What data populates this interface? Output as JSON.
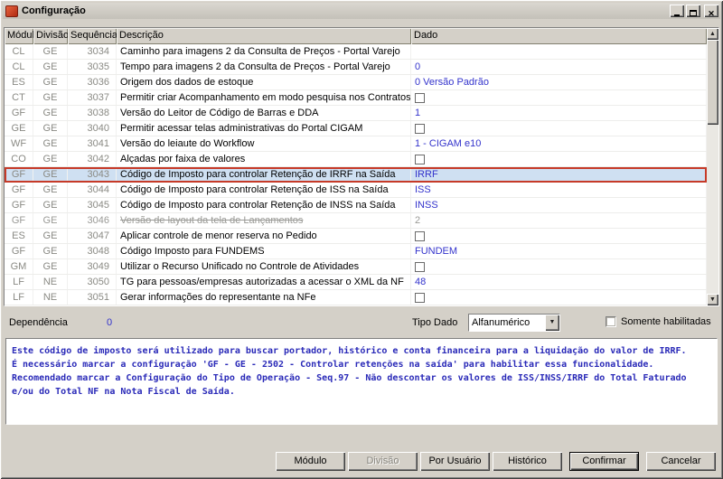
{
  "window": {
    "title": "Configuração"
  },
  "grid": {
    "columns": [
      "Módulo",
      "Divisão",
      "Sequência",
      "Descrição",
      "Dado"
    ],
    "rows": [
      {
        "modulo": "CL",
        "divisao": "GE",
        "seq": "3034",
        "descricao": "Caminho para imagens 2 da Consulta de Preços - Portal Varejo",
        "tipo": "text",
        "dado": "",
        "selected": false,
        "strike": false
      },
      {
        "modulo": "CL",
        "divisao": "GE",
        "seq": "3035",
        "descricao": "Tempo para imagens 2 da Consulta de Preços - Portal Varejo",
        "tipo": "text",
        "dado": "0",
        "selected": false,
        "strike": false
      },
      {
        "modulo": "ES",
        "divisao": "GE",
        "seq": "3036",
        "descricao": "Origem dos dados de estoque",
        "tipo": "text",
        "dado": "0 Versão Padrão",
        "selected": false,
        "strike": false
      },
      {
        "modulo": "CT",
        "divisao": "GE",
        "seq": "3037",
        "descricao": "Permitir criar Acompanhamento em modo pesquisa nos Contratos",
        "tipo": "checkbox",
        "dado": "",
        "selected": false,
        "strike": false
      },
      {
        "modulo": "GF",
        "divisao": "GE",
        "seq": "3038",
        "descricao": "Versão do Leitor de Código de Barras e DDA",
        "tipo": "text",
        "dado": "1",
        "selected": false,
        "strike": false
      },
      {
        "modulo": "GE",
        "divisao": "GE",
        "seq": "3040",
        "descricao": "Permitir acessar telas administrativas do Portal CIGAM",
        "tipo": "checkbox",
        "dado": "",
        "selected": false,
        "strike": false
      },
      {
        "modulo": "WF",
        "divisao": "GE",
        "seq": "3041",
        "descricao": "Versão do leiaute do Workflow",
        "tipo": "text",
        "dado": "1 - CIGAM e10",
        "selected": false,
        "strike": false
      },
      {
        "modulo": "CO",
        "divisao": "GE",
        "seq": "3042",
        "descricao": "Alçadas por faixa de valores",
        "tipo": "checkbox",
        "dado": "",
        "selected": false,
        "strike": false
      },
      {
        "modulo": "GF",
        "divisao": "GE",
        "seq": "3043",
        "descricao": "Código de Imposto para controlar Retenção de IRRF na Saída",
        "tipo": "text",
        "dado": "IRRF",
        "selected": true,
        "strike": false
      },
      {
        "modulo": "GF",
        "divisao": "GE",
        "seq": "3044",
        "descricao": "Código de Imposto para controlar Retenção de ISS na Saída",
        "tipo": "text",
        "dado": "ISS",
        "selected": false,
        "strike": false
      },
      {
        "modulo": "GF",
        "divisao": "GE",
        "seq": "3045",
        "descricao": "Código de Imposto para controlar Retenção de INSS na Saída",
        "tipo": "text",
        "dado": "INSS",
        "selected": false,
        "strike": false
      },
      {
        "modulo": "GF",
        "divisao": "GE",
        "seq": "3046",
        "descricao": "Versão de layout da tela de Lançamentos",
        "tipo": "text",
        "dado": "2",
        "selected": false,
        "strike": true
      },
      {
        "modulo": "ES",
        "divisao": "GE",
        "seq": "3047",
        "descricao": "Aplicar controle de menor reserva no Pedido",
        "tipo": "checkbox",
        "dado": "",
        "selected": false,
        "strike": false
      },
      {
        "modulo": "GF",
        "divisao": "GE",
        "seq": "3048",
        "descricao": "Código Imposto para FUNDEMS",
        "tipo": "text",
        "dado": "FUNDEM",
        "selected": false,
        "strike": false
      },
      {
        "modulo": "GM",
        "divisao": "GE",
        "seq": "3049",
        "descricao": "Utilizar o Recurso Unificado no Controle de Atividades",
        "tipo": "checkbox",
        "dado": "",
        "selected": false,
        "strike": false
      },
      {
        "modulo": "LF",
        "divisao": "NE",
        "seq": "3050",
        "descricao": "TG para pessoas/empresas autorizadas a acessar o XML da NF",
        "tipo": "text",
        "dado": "48",
        "selected": false,
        "strike": false
      },
      {
        "modulo": "LF",
        "divisao": "NE",
        "seq": "3051",
        "descricao": "Gerar informações do representante na NFe",
        "tipo": "checkbox",
        "dado": "",
        "selected": false,
        "strike": false
      }
    ]
  },
  "footer": {
    "dependencia_label": "Dependência",
    "dependencia_value": "0",
    "tipo_dado_label": "Tipo Dado",
    "tipo_dado_value": "Alfanumérico",
    "somente_habilitadas_label": "Somente habilitadas"
  },
  "info": {
    "lines": [
      "Este código de imposto será utilizado para buscar portador, histórico e conta financeira para a liquidação do valor de IRRF.",
      "É necessário marcar a configuração 'GF - GE - 2502 - Controlar retenções na saída' para habilitar essa funcionalidade.",
      "Recomendado marcar a Configuração do Tipo de Operação - Seq.97 - Não descontar os valores de ISS/INSS/IRRF do Total Faturado",
      "e/ou do Total NF na Nota Fiscal de Saída."
    ]
  },
  "buttons": {
    "modulo": "Módulo",
    "divisao": "Divisão",
    "por_usuario": "Por Usuário",
    "historico": "Histórico",
    "confirmar": "Confirmar",
    "cancelar": "Cancelar"
  },
  "colors": {
    "selected_row_bg": "#cfe0f2",
    "selected_row_border": "#c63a28",
    "dado_text": "#3333cc"
  }
}
